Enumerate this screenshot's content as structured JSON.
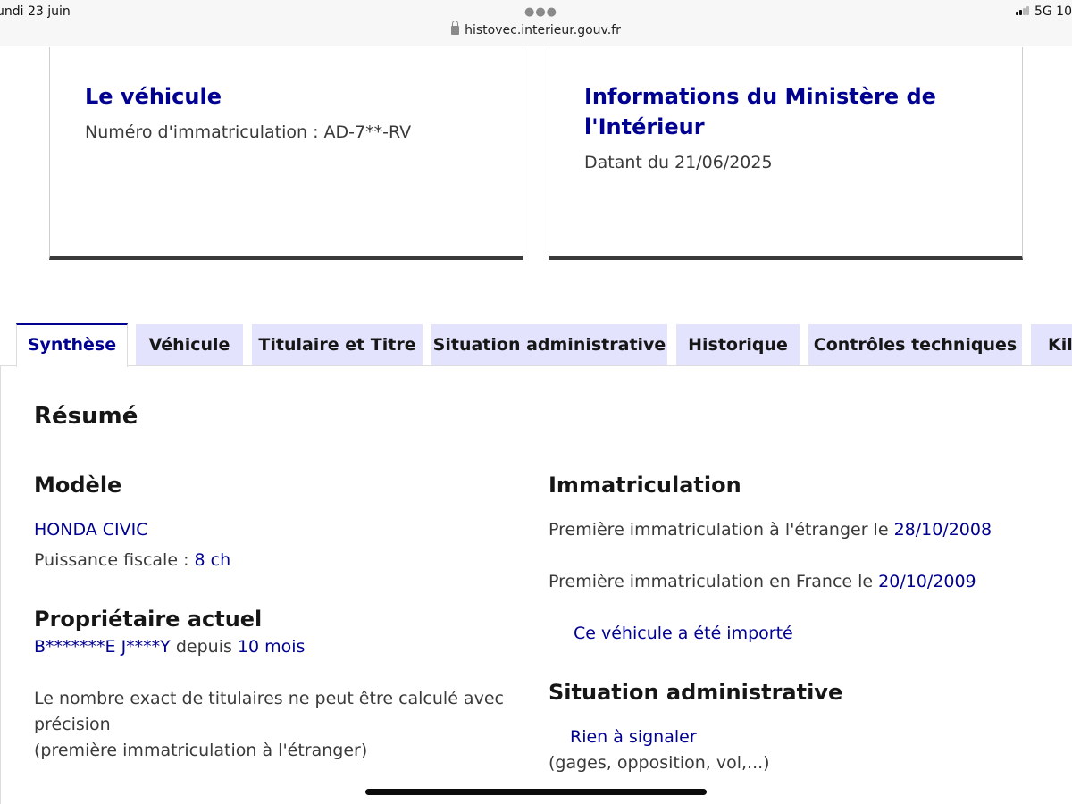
{
  "status": {
    "date": "undi 23 juin",
    "url": "histovec.interieur.gouv.fr",
    "network": "5G",
    "battery": "10"
  },
  "cards": {
    "vehicle": {
      "title": "Le véhicule",
      "desc": "Numéro d'immatriculation : AD-7**-RV"
    },
    "ministry": {
      "title": "Informations du Ministère de l'Intérieur",
      "desc": "Datant du 21/06/2025"
    }
  },
  "tabs": [
    {
      "label": "Synthèse"
    },
    {
      "label": "Véhicule"
    },
    {
      "label": "Titulaire et Titre"
    },
    {
      "label": "Situation administrative"
    },
    {
      "label": "Historique"
    },
    {
      "label": "Contrôles techniques"
    },
    {
      "label": "Kilo"
    }
  ],
  "summary": {
    "title": "Résumé",
    "model": {
      "heading": "Modèle",
      "name": "HONDA CIVIC",
      "power_label": "Puissance fiscale : ",
      "power_value": "8 ch"
    },
    "owner": {
      "heading": "Propriétaire actuel",
      "name": "B*******E J****Y",
      "since_label": " depuis ",
      "since_value": "10 mois",
      "note_line1": "Le nombre exact de titulaires ne peut être calculé avec",
      "note_line2": "précision",
      "note_line3": "(première immatriculation à l'étranger)"
    },
    "registration": {
      "heading": "Immatriculation",
      "foreign_label": "Première immatriculation à l'étranger le ",
      "foreign_date": "28/10/2008",
      "france_label": "Première immatriculation en France le ",
      "france_date": "20/10/2009",
      "imported": "Ce véhicule a été importé"
    },
    "admin": {
      "heading": "Situation administrative",
      "status": "Rien à signaler",
      "detail": "(gages, opposition, vol,...)"
    }
  }
}
